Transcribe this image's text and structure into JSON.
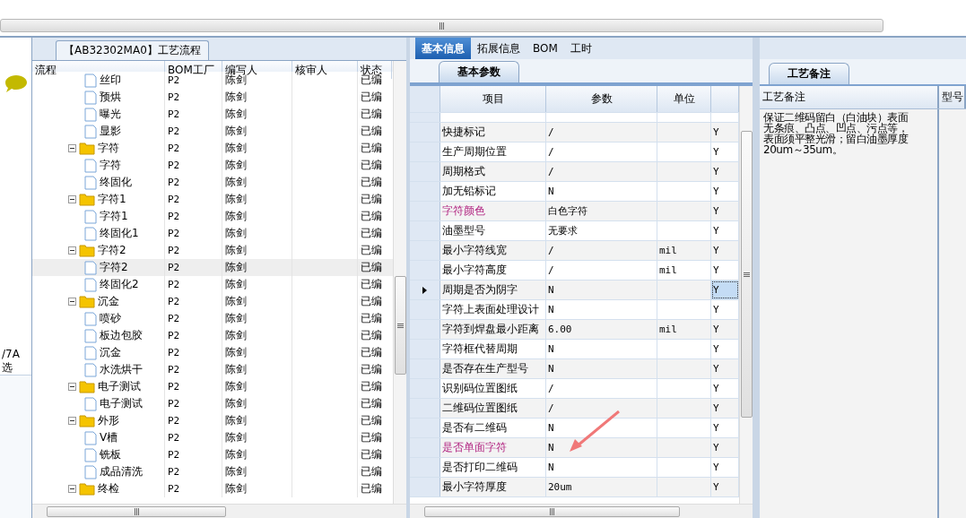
{
  "left_strip": {
    "texts": [
      "/7A",
      "选"
    ]
  },
  "tree_panel": {
    "title": "【AB32302MA0】工艺流程",
    "columns": [
      "流程",
      "BOM工厂",
      "编写人",
      "核审人",
      "状态"
    ],
    "nodes": [
      {
        "children": [
          {
            "label": "丝印",
            "bom": "P2",
            "author": "陈剑",
            "status": "已编",
            "selected": false
          },
          {
            "label": "预烘",
            "bom": "P2",
            "author": "陈剑",
            "status": "已编",
            "selected": false
          },
          {
            "label": "曝光",
            "bom": "P2",
            "author": "陈剑",
            "status": "已编",
            "selected": false
          },
          {
            "label": "显影",
            "bom": "P2",
            "author": "陈剑",
            "status": "已编",
            "selected": false
          }
        ]
      },
      {
        "label": "字符",
        "bom": "P2",
        "author": "陈剑",
        "status": "已编",
        "selected": false,
        "expanded": true,
        "children": [
          {
            "label": "字符",
            "bom": "P2",
            "author": "陈剑",
            "status": "已编",
            "selected": false
          },
          {
            "label": "终固化",
            "bom": "P2",
            "author": "陈剑",
            "status": "已编",
            "selected": false
          }
        ]
      },
      {
        "label": "字符1",
        "bom": "P2",
        "author": "陈剑",
        "status": "已编",
        "selected": false,
        "expanded": true,
        "children": [
          {
            "label": "字符1",
            "bom": "P2",
            "author": "陈剑",
            "status": "已编",
            "selected": false
          },
          {
            "label": "终固化1",
            "bom": "P2",
            "author": "陈剑",
            "status": "已编",
            "selected": false
          }
        ]
      },
      {
        "label": "字符2",
        "bom": "P2",
        "author": "陈剑",
        "status": "已编",
        "selected": false,
        "expanded": true,
        "children": [
          {
            "label": "字符2",
            "bom": "P2",
            "author": "陈剑",
            "status": "已编",
            "selected": true
          },
          {
            "label": "终固化2",
            "bom": "P2",
            "author": "陈剑",
            "status": "已编",
            "selected": false
          }
        ]
      },
      {
        "label": "沉金",
        "bom": "P2",
        "author": "陈剑",
        "status": "已编",
        "selected": false,
        "expanded": true,
        "children": [
          {
            "label": "喷砂",
            "bom": "P2",
            "author": "陈剑",
            "status": "已编",
            "selected": false
          },
          {
            "label": "板边包胶",
            "bom": "P2",
            "author": "陈剑",
            "status": "已编",
            "selected": false
          },
          {
            "label": "沉金",
            "bom": "P2",
            "author": "陈剑",
            "status": "已编",
            "selected": false
          },
          {
            "label": "水洗烘干",
            "bom": "P2",
            "author": "陈剑",
            "status": "已编",
            "selected": false
          }
        ]
      },
      {
        "label": "电子测试",
        "bom": "P2",
        "author": "陈剑",
        "status": "已编",
        "selected": false,
        "expanded": true,
        "children": [
          {
            "label": "电子测试",
            "bom": "P2",
            "author": "陈剑",
            "status": "已编",
            "selected": false
          }
        ]
      },
      {
        "label": "外形",
        "bom": "P2",
        "author": "陈剑",
        "status": "已编",
        "selected": false,
        "expanded": true,
        "children": [
          {
            "label": "V槽",
            "bom": "P2",
            "author": "陈剑",
            "status": "已编",
            "selected": false
          },
          {
            "label": "铣板",
            "bom": "P2",
            "author": "陈剑",
            "status": "已编",
            "selected": false
          },
          {
            "label": "成品清洗",
            "bom": "P2",
            "author": "陈剑",
            "status": "已编",
            "selected": false
          }
        ]
      },
      {
        "label": "终检",
        "bom": "P2",
        "author": "陈剑",
        "status": "已编",
        "selected": false,
        "expanded": true
      }
    ]
  },
  "detail_panel": {
    "tabs": [
      {
        "label": "基本信息",
        "selected": true
      },
      {
        "label": "拓展信息",
        "selected": false
      },
      {
        "label": "BOM",
        "selected": false
      },
      {
        "label": "工时",
        "selected": false
      }
    ],
    "subtab": "基本参数",
    "columns": [
      "项目",
      "参数",
      "单位"
    ],
    "rows": [
      {
        "item": "快捷标记",
        "value": "/",
        "unit": "",
        "flag": "Y",
        "highlighted": false,
        "selected": false
      },
      {
        "item": "生产周期位置",
        "value": "/",
        "unit": "",
        "flag": "Y",
        "highlighted": false,
        "selected": false
      },
      {
        "item": "周期格式",
        "value": "/",
        "unit": "",
        "flag": "Y",
        "highlighted": false,
        "selected": false
      },
      {
        "item": "加无铅标记",
        "value": "N",
        "unit": "",
        "flag": "Y",
        "highlighted": false,
        "selected": false
      },
      {
        "item": "字符颜色",
        "value": "白色字符",
        "unit": "",
        "flag": "Y",
        "highlighted": true,
        "selected": false
      },
      {
        "item": "油墨型号",
        "value": "无要求",
        "unit": "",
        "flag": "Y",
        "highlighted": false,
        "selected": false
      },
      {
        "item": "最小字符线宽",
        "value": "/",
        "unit": "mil",
        "flag": "Y",
        "highlighted": false,
        "selected": false
      },
      {
        "item": "最小字符高度",
        "value": "/",
        "unit": "mil",
        "flag": "Y",
        "highlighted": false,
        "selected": false
      },
      {
        "item": "周期是否为阴字",
        "value": "N",
        "unit": "",
        "flag": "Y",
        "highlighted": false,
        "selected": true
      },
      {
        "item": "字符上表面处理设计",
        "value": "N",
        "unit": "",
        "flag": "Y",
        "highlighted": false,
        "selected": false
      },
      {
        "item": "字符到焊盘最小距离",
        "value": "6.00",
        "unit": "mil",
        "flag": "Y",
        "highlighted": false,
        "selected": false
      },
      {
        "item": "字符框代替周期",
        "value": "N",
        "unit": "",
        "flag": "Y",
        "highlighted": false,
        "selected": false
      },
      {
        "item": "是否存在生产型号",
        "value": "N",
        "unit": "",
        "flag": "Y",
        "highlighted": false,
        "selected": false
      },
      {
        "item": "识别码位置图纸",
        "value": "/",
        "unit": "",
        "flag": "Y",
        "highlighted": false,
        "selected": false
      },
      {
        "item": "二维码位置图纸",
        "value": "/",
        "unit": "",
        "flag": "Y",
        "highlighted": false,
        "selected": false
      },
      {
        "item": "是否有二维码",
        "value": "N",
        "unit": "",
        "flag": "Y",
        "highlighted": false,
        "selected": false
      },
      {
        "item": "是否单面字符",
        "value": "N",
        "unit": "",
        "flag": "Y",
        "highlighted": true,
        "selected": false
      },
      {
        "item": "是否打印二维码",
        "value": "N",
        "unit": "",
        "flag": "Y",
        "highlighted": false,
        "selected": false
      },
      {
        "item": "最小字符厚度",
        "value": "20um",
        "unit": "",
        "flag": "Y",
        "highlighted": false,
        "selected": false
      }
    ]
  },
  "notes_panel": {
    "tab": "工艺备注",
    "columns": [
      "工艺备注",
      "型号"
    ],
    "note": "保证二维码留白（白油块）表面无条痕、凸点、凹点、污点等，表面须平整光滑；留白油墨厚度20um～35um。"
  }
}
